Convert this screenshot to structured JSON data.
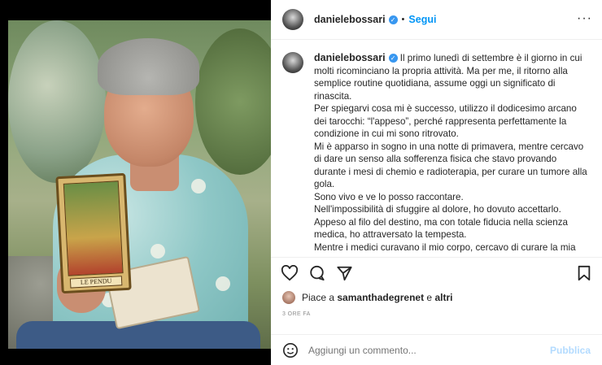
{
  "photo": {
    "card_label": "LE PENDU"
  },
  "header": {
    "username": "danielebossari",
    "separator": "•",
    "follow_label": "Segui",
    "more": "···"
  },
  "caption": {
    "username": "danielebossari",
    "paragraphs": [
      "Il primo lunedì di settembre è il giorno in cui molti ricominciano la propria attività. Ma per me, il ritorno alla semplice routine quotidiana, assume oggi un significato di rinascita.",
      "Per spiegarvi cosa mi è successo, utilizzo il dodicesimo arcano dei tarocchi: “l'appeso”, perché rappresenta perfettamente la condizione in cui mi sono ritrovato.",
      "Mi è apparso in sogno in una notte di primavera, mentre cercavo di dare un senso alla sofferenza fisica che stavo provando durante i mesi di chemio e radioterapia, per curare un tumore alla gola.",
      "Sono vivo e ve lo posso raccontare.",
      "Nell'impossibilità di sfuggire al dolore, ho dovuto accettarlo.",
      "Appeso al filo del destino, ma con totale fiducia nella scienza medica, ho attraversato la tempesta.",
      "Mentre i medici curavano il mio corpo, cercavo di curare la mia anima mettendo in pratica quegli insegnamenti dettati da tutti i"
    ]
  },
  "likes": {
    "prefix": "Piace a",
    "user": "samanthadegrenet",
    "conj": "e",
    "others": "altri"
  },
  "time": "3 ORE FA",
  "comment": {
    "placeholder": "Aggiungi un commento...",
    "post_label": "Pubblica"
  }
}
